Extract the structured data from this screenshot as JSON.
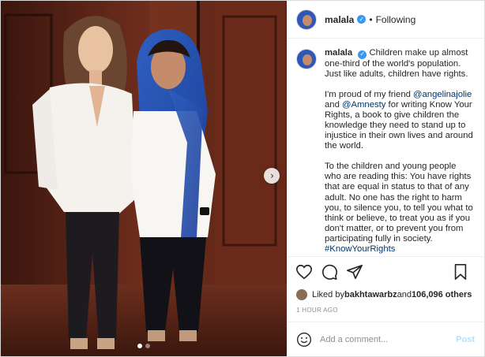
{
  "header": {
    "username": "malala",
    "separator": "•",
    "follow_status": "Following"
  },
  "caption": {
    "username": "malala",
    "para1": "Children make up almost one-third of the world's population. Just like adults, children have rights.",
    "para2_pre": "I'm proud of my friend ",
    "mention1": "@angelinajolie",
    "para2_mid": " and ",
    "mention2": "@Amnesty",
    "para2_post": " for writing Know Your Rights, a book to give children the knowledge they need to stand up to injustice in their own lives and around the world.",
    "para3": "To the children and young people who are reading this: You have rights that are equal in status to that of any adult. No one has the right to harm you, to silence you, to tell you what to think or believe, to treat you as if you don't matter, or to prevent you from participating fully in society.",
    "hashtag": "#KnowYourRights"
  },
  "likes": {
    "prefix": "Liked by ",
    "user": "bakhtawarbz",
    "middle": " and ",
    "count": "106,096 others"
  },
  "timestamp": "1 HOUR AGO",
  "comment": {
    "placeholder": "Add a comment...",
    "post_label": "Post"
  },
  "carousel": {
    "next_glyph": "›",
    "slides": 2,
    "active": 0
  },
  "colors": {
    "verified": "#3897f0",
    "link": "#003569",
    "post_disabled": "#b2dffc",
    "muted": "#8e8e8e"
  },
  "icons": [
    "verified-badge-icon",
    "heart-icon",
    "comment-icon",
    "share-icon",
    "bookmark-icon",
    "emoji-icon",
    "chevron-right-icon"
  ]
}
